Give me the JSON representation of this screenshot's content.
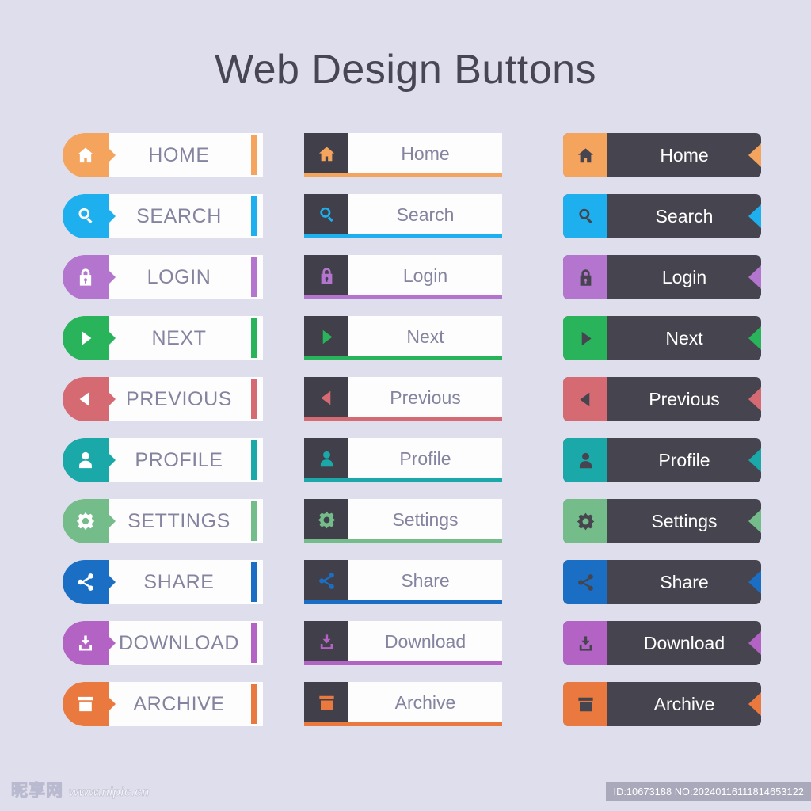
{
  "page": {
    "title": "Web Design Buttons",
    "background_color": "#dfdeec",
    "title_color": "#484654",
    "dark_color": "#46444f",
    "white_color": "#fdfdfd",
    "label_gray": "#8484a0"
  },
  "buttons": [
    {
      "icon": "home-icon",
      "color": "#f5a45e",
      "caps": "HOME",
      "title": "Home"
    },
    {
      "icon": "search-icon",
      "color": "#1eb0ee",
      "caps": "SEARCH",
      "title": "Search"
    },
    {
      "icon": "lock-icon",
      "color": "#b375cd",
      "caps": "LOGIN",
      "title": "Login"
    },
    {
      "icon": "play-icon",
      "color": "#29b35b",
      "caps": "NEXT",
      "title": "Next"
    },
    {
      "icon": "back-icon",
      "color": "#d66a73",
      "caps": "PREVIOUS",
      "title": "Previous"
    },
    {
      "icon": "user-icon",
      "color": "#1aa8a8",
      "caps": "PROFILE",
      "title": "Profile"
    },
    {
      "icon": "gear-icon",
      "color": "#74bd8a",
      "caps": "SETTINGS",
      "title": "Settings"
    },
    {
      "icon": "share-icon",
      "color": "#1a6fc4",
      "caps": "SHARE",
      "title": "Share"
    },
    {
      "icon": "download-icon",
      "color": "#b263c4",
      "caps": "DOWNLOAD",
      "title": "Download"
    },
    {
      "icon": "archive-icon",
      "color": "#e9793f",
      "caps": "ARCHIVE",
      "title": "Archive"
    }
  ],
  "footer": {
    "watermark_cn": "昵享网",
    "watermark_url": "www.nipic.cn",
    "id_text": "ID:10673188 NO:20240116111814653122"
  }
}
